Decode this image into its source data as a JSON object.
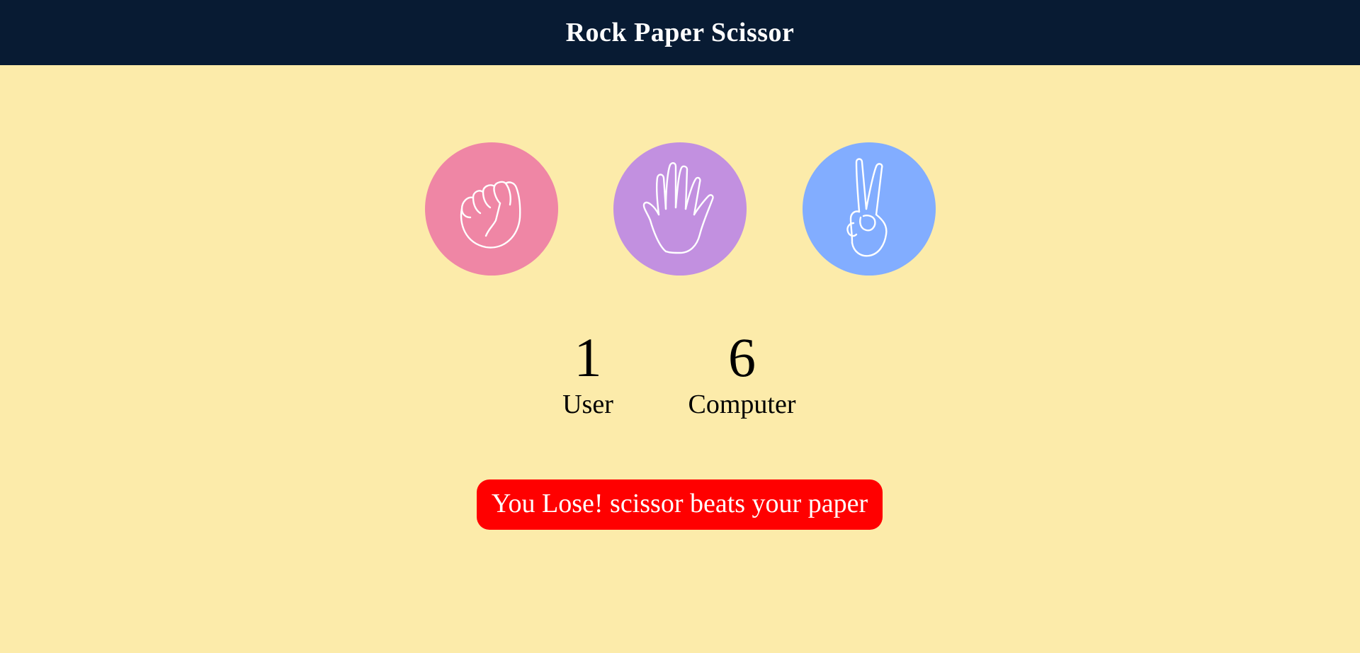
{
  "header": {
    "title": "Rock Paper Scissor"
  },
  "choices": [
    {
      "id": "rock",
      "icon": "rock-hand-icon",
      "color": "#ef86a5"
    },
    {
      "id": "paper",
      "icon": "paper-hand-icon",
      "color": "#c290e0"
    },
    {
      "id": "scissor",
      "icon": "scissor-hand-icon",
      "color": "#82adff"
    }
  ],
  "scoreboard": {
    "user_score": "1",
    "user_label": "User",
    "computer_score": "6",
    "computer_label": "Computer"
  },
  "message": {
    "text": "You Lose! scissor beats your paper",
    "color": "#ff0000"
  }
}
